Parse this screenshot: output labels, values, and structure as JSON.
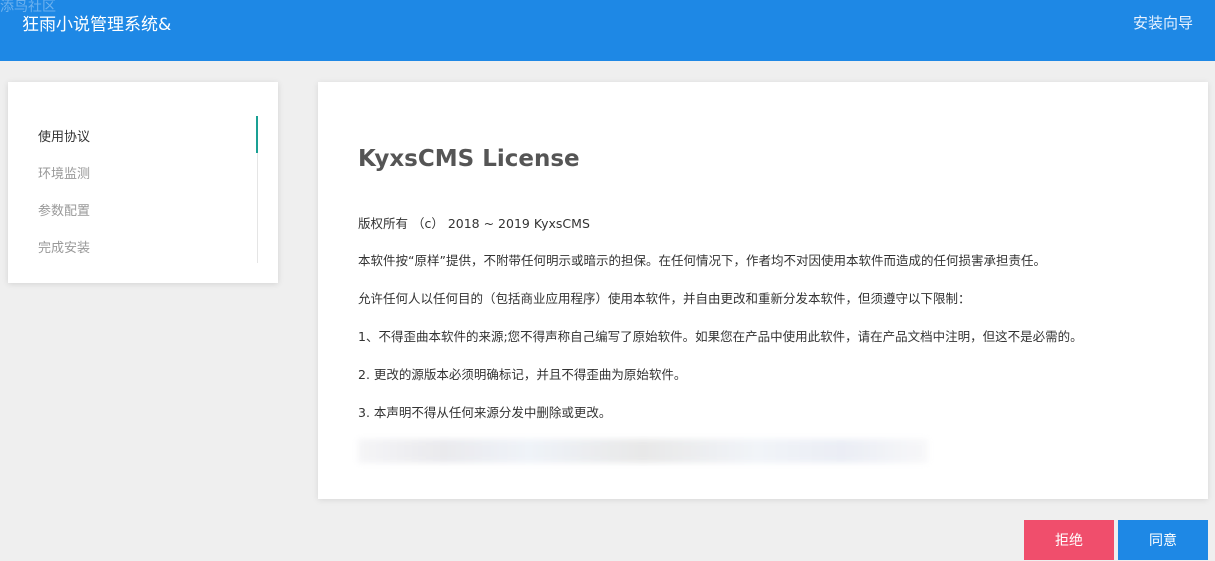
{
  "header": {
    "watermark": "添鸟社区",
    "brand": "狂雨小说管理系统&",
    "wizard": "安装向导"
  },
  "steps": [
    {
      "label": "使用协议",
      "active": true
    },
    {
      "label": "环境监测",
      "active": false
    },
    {
      "label": "参数配置",
      "active": false
    },
    {
      "label": "完成安装",
      "active": false
    }
  ],
  "license": {
    "title": "KyxsCMS License",
    "copyright": "版权所有 （c） 2018 ~ 2019 KyxsCMS",
    "p1": "本软件按“原样”提供，不附带任何明示或暗示的担保。在任何情况下，作者均不对因使用本软件而造成的任何损害承担责任。",
    "p2": "允许任何人以任何目的（包括商业应用程序）使用本软件，并自由更改和重新分发本软件，但须遵守以下限制：",
    "p3": "1、不得歪曲本软件的来源;您不得声称自己编写了原始软件。如果您在产品中使用此软件，请在产品文档中注明，但这不是必需的。",
    "p4": "2. 更改的源版本必须明确标记，并且不得歪曲为原始软件。",
    "p5": "3. 本声明不得从任何来源分发中删除或更改。"
  },
  "actions": {
    "reject": "拒绝",
    "agree": "同意"
  },
  "colors": {
    "header": "#1e88e5",
    "reject": "#f04e6c",
    "agree": "#1e88e5",
    "step_active_line": "#1aa094"
  }
}
